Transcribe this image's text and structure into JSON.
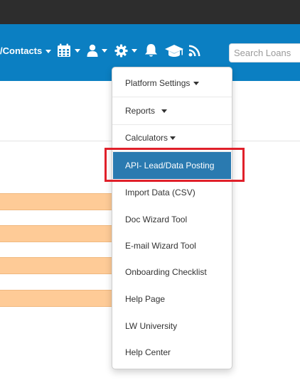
{
  "navbar": {
    "contacts_label": "/Contacts",
    "icons": [
      "calendar-icon",
      "user-icon",
      "gear-icon",
      "bell-icon",
      "graduation-cap-icon",
      "rss-icon"
    ],
    "search_placeholder": "Search Loans"
  },
  "dropdown_menu": {
    "items": [
      {
        "label": "Platform Settings",
        "has_caret": true
      },
      {
        "label": "Reports",
        "has_caret": true
      },
      {
        "label": "Calculators",
        "has_caret": true
      },
      {
        "label": "API- Lead/Data Posting",
        "active": true
      },
      {
        "label": "Import Data (CSV)"
      },
      {
        "label": "Doc Wizard Tool"
      },
      {
        "label": "E-mail Wizard Tool"
      },
      {
        "label": "Onboarding Checklist"
      },
      {
        "label": "Help Page"
      },
      {
        "label": "LW University"
      },
      {
        "label": "Help Center"
      }
    ]
  },
  "colors": {
    "top_bar": "#2d2d2d",
    "navbar": "#0b7fc2",
    "menu_active": "#2a7ab0",
    "highlight_border": "#e0202a",
    "row_highlight": "#fecb97"
  }
}
